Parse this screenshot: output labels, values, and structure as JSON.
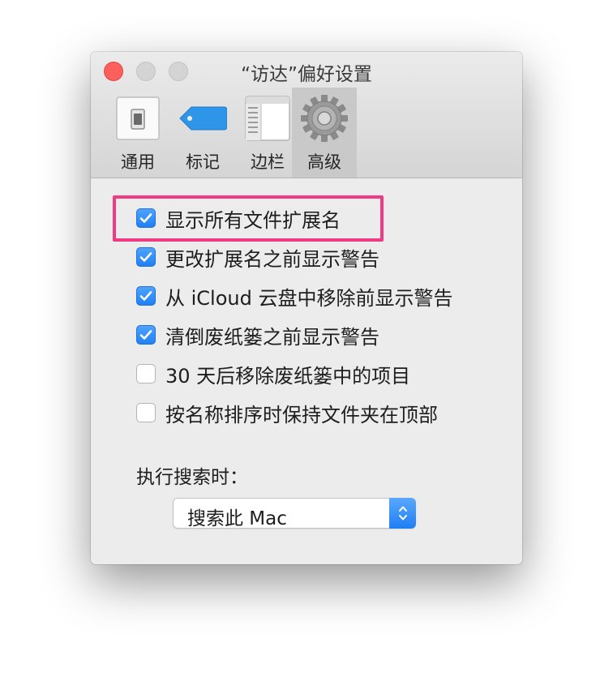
{
  "window": {
    "title": "“访达”偏好设置"
  },
  "tabs": [
    {
      "label": "通用",
      "icon": "switch-icon",
      "selected": false
    },
    {
      "label": "标记",
      "icon": "tag-icon",
      "selected": false
    },
    {
      "label": "边栏",
      "icon": "sidebar-icon",
      "selected": false
    },
    {
      "label": "高级",
      "icon": "gear-icon",
      "selected": true
    }
  ],
  "options": [
    {
      "label": "显示所有文件扩展名",
      "checked": true
    },
    {
      "label": "更改扩展名之前显示警告",
      "checked": true
    },
    {
      "label": "从 iCloud 云盘中移除前显示警告",
      "checked": true
    },
    {
      "label": "清倒废纸篓之前显示警告",
      "checked": true
    },
    {
      "label": "30 天后移除废纸篓中的项目",
      "checked": false
    },
    {
      "label": "按名称排序时保持文件夹在顶部",
      "checked": false
    }
  ],
  "search": {
    "label": "执行搜索时：",
    "selected_value": "搜索此 Mac"
  },
  "colors": {
    "accent": "#1f80f5",
    "highlight": "#ef3b84",
    "close_button": "#fc605c"
  }
}
